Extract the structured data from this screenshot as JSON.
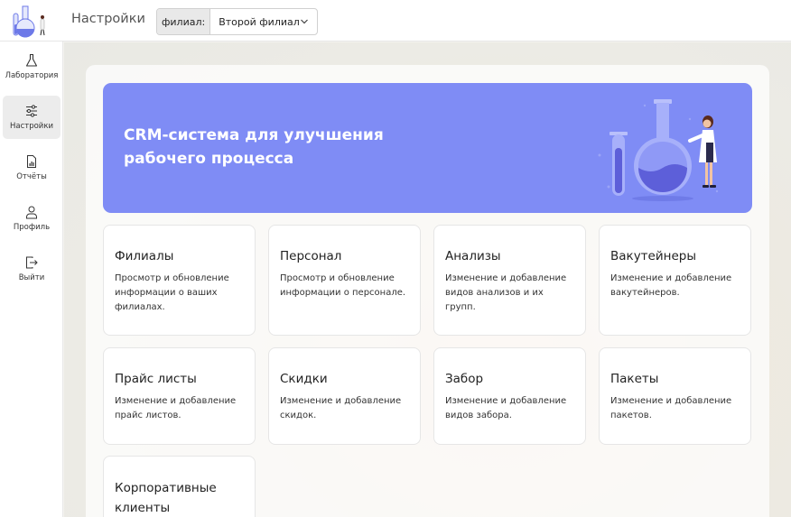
{
  "header": {
    "title": "Настройки",
    "branch_label": "филиал:",
    "branch_value": "Второй филиал"
  },
  "sidebar": {
    "items": [
      {
        "label": "Лаборатория",
        "icon": "flask-icon"
      },
      {
        "label": "Настройки",
        "icon": "sliders-icon"
      },
      {
        "label": "Отчёты",
        "icon": "report-icon"
      },
      {
        "label": "Профиль",
        "icon": "user-icon"
      },
      {
        "label": "Выйти",
        "icon": "logout-icon"
      }
    ]
  },
  "banner": {
    "line1": "CRM-система для улучшения",
    "line2": "рабочего процесса"
  },
  "cards": [
    {
      "title": "Филиалы",
      "desc": "Просмотр и обновление информации о ваших филиалах."
    },
    {
      "title": "Персонал",
      "desc": "Просмотр и обновление информации о персонале."
    },
    {
      "title": "Анализы",
      "desc": "Изменение и добавление видов анализов и их групп."
    },
    {
      "title": "Вакутейнеры",
      "desc": "Изменение и добавление вакутейнеров."
    },
    {
      "title": "Прайс листы",
      "desc": "Изменение и добавление прайс листов."
    },
    {
      "title": "Скидки",
      "desc": "Изменение и добавление скидок."
    },
    {
      "title": "Забор",
      "desc": "Изменение и добавление видов забора."
    },
    {
      "title": "Пакеты",
      "desc": "Изменение и добавление пакетов."
    },
    {
      "title": "Корпоративные клиенты",
      "desc": ""
    }
  ],
  "colors": {
    "accent": "#7f8cf5",
    "active_nav": "#ececec"
  }
}
